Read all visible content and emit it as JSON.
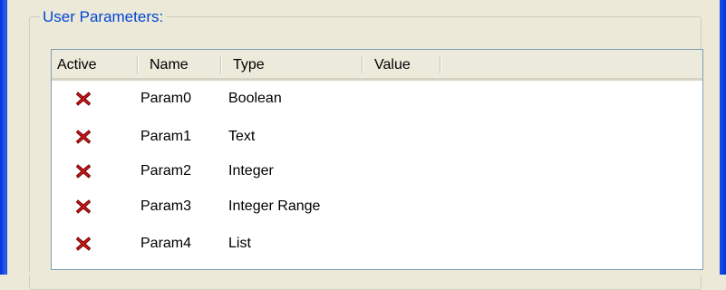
{
  "group": {
    "title": "User Parameters:"
  },
  "columns": [
    "Active",
    "Name",
    "Type",
    "Value"
  ],
  "rows": [
    {
      "active_icon": "red-x-icon",
      "name": "Param0",
      "type": "Boolean",
      "value": ""
    },
    {
      "active_icon": "red-x-icon",
      "name": "Param1",
      "type": "Text",
      "value": ""
    },
    {
      "active_icon": "red-x-icon",
      "name": "Param2",
      "type": "Integer",
      "value": ""
    },
    {
      "active_icon": "red-x-icon",
      "name": "Param3",
      "type": "Integer Range",
      "value": ""
    },
    {
      "active_icon": "red-x-icon",
      "name": "Param4",
      "type": "List",
      "value": ""
    }
  ],
  "colors": {
    "window_frame": "#0a46e6",
    "group_title": "#0046d5",
    "inactive_x": "#c41a1a"
  }
}
